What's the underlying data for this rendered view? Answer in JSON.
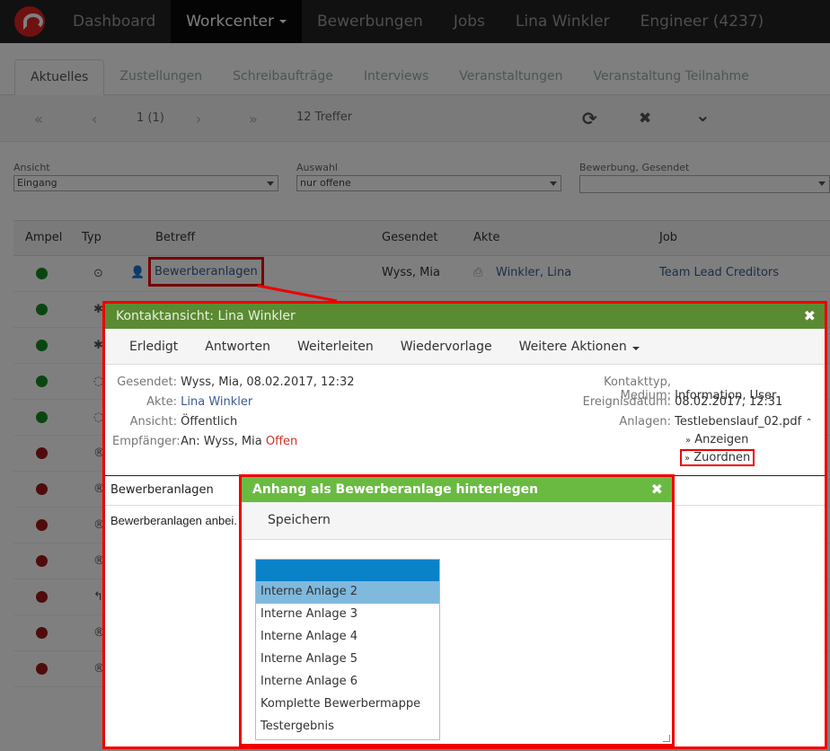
{
  "navbar": {
    "items": [
      "Dashboard",
      "Workcenter",
      "Bewerbungen",
      "Jobs",
      "Lina Winkler",
      "Engineer (4237)"
    ]
  },
  "tabs": [
    "Aktuelles",
    "Zustellungen",
    "Schreibaufträge",
    "Interviews",
    "Veranstaltungen",
    "Veranstaltung Teilnahme"
  ],
  "pager": {
    "first": "«",
    "prev": "‹",
    "page": "1 (1)",
    "next": "›",
    "last": "»",
    "hits": "12 Treffer",
    "refresh": "⟳",
    "clear": "✖",
    "expand": "⌄"
  },
  "filters": {
    "ansicht": {
      "label": "Ansicht",
      "value": "Eingang"
    },
    "auswahl": {
      "label": "Auswahl",
      "value": "nur offene"
    },
    "bewerbung": {
      "label": "Bewerbung, Gesendet",
      "value": ""
    }
  },
  "table": {
    "headers": [
      "Ampel",
      "Typ",
      "Betreff",
      "Gesendet",
      "Akte",
      "Job"
    ],
    "first_row": {
      "betreff": "Bewerberanlagen",
      "gesendet": "Wyss, Mia",
      "akte": "Winkler, Lina",
      "job": "Team Lead Creditors"
    },
    "ampel": [
      "green",
      "green",
      "green",
      "green",
      "green",
      "red",
      "red",
      "red",
      "red",
      "red",
      "red",
      "red"
    ],
    "type_icons": [
      "⊙",
      "✱",
      "✱",
      "◌",
      "◌",
      "®",
      "®",
      "®",
      "®",
      "↰",
      "®",
      "®"
    ]
  },
  "dialog1": {
    "title": "Kontaktansicht: Lina Winkler",
    "close": "✖",
    "menu": [
      "Erledigt",
      "Antworten",
      "Weiterleiten",
      "Wiedervorlage",
      "Weitere Aktionen"
    ],
    "left": [
      {
        "k": "Gesendet:",
        "v": "Wyss, Mia, 08.02.2017, 12:32"
      },
      {
        "k": "Akte:",
        "v": "Lina Winkler"
      },
      {
        "k": "Ansicht:",
        "v": "Öffentlich"
      },
      {
        "k": "Empfänger:",
        "v": "An: Wyss, Mia"
      }
    ],
    "status": "Offen",
    "right": [
      {
        "k": "Kontakttyp, Medium:",
        "v": "Information, User"
      },
      {
        "k": "Ereignisdatum:",
        "v": "08.02.2017, 12:31"
      },
      {
        "k": "Anlagen:",
        "v": "Testlebenslauf_02.pdf"
      }
    ],
    "actions": [
      "Anzeigen",
      "Zuordnen"
    ],
    "subject": "Bewerberanlagen",
    "body": "Bewerberanlagen anbei."
  },
  "dialog2": {
    "title": "Anhang als Bewerberanlage hinterlegen",
    "close": "✖",
    "save": "Speichern",
    "options": [
      "",
      "Interne Anlage 2",
      "Interne Anlage 3",
      "Interne Anlage 4",
      "Interne Anlage 5",
      "Interne Anlage 6",
      "Komplette Bewerbermappe",
      "Testergebnis"
    ]
  },
  "colors": {
    "accent": "#5a8a32",
    "accent2": "#6aba42",
    "highlight": "#ee0000",
    "select": "#0a82c8"
  }
}
